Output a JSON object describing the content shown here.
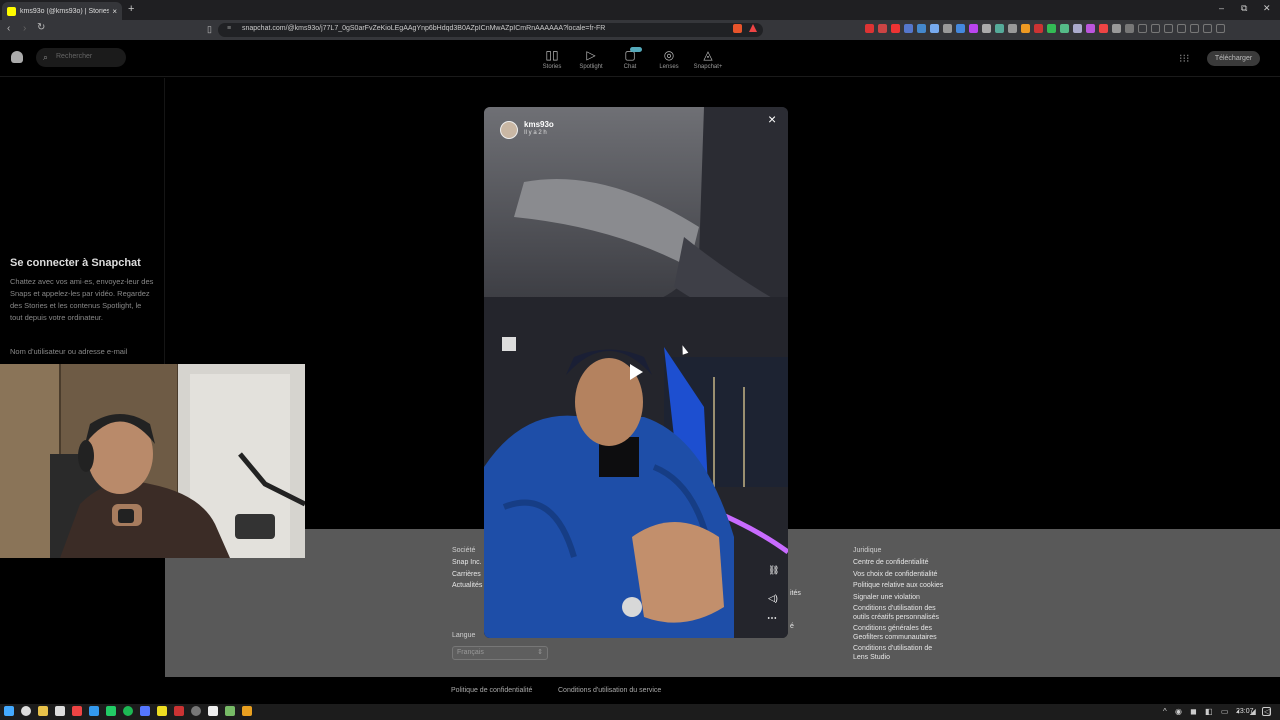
{
  "browser": {
    "tab_title": "kms93o (@kms93o) | Stories, Sp",
    "tab_close": "×",
    "new_tab": "+",
    "window_controls": [
      "–",
      "⧉",
      "✕"
    ],
    "url": "snapchat.com/@kms93o/j77L7_0gS0arFvZeKioLEgAAgYnp6bHdqd3B0AZpICnMwAZpICmRnAAAAAA?locale=fr-FR",
    "nav_icons": [
      "back-icon",
      "forward-icon",
      "reload-icon"
    ]
  },
  "header": {
    "search_placeholder": "Rechercher",
    "nav": [
      {
        "label": "Stories",
        "icon": "stories-icon"
      },
      {
        "label": "Spotlight",
        "icon": "spotlight-icon"
      },
      {
        "label": "Chat",
        "icon": "chat-icon"
      },
      {
        "label": "Lenses",
        "icon": "lenses-icon"
      },
      {
        "label": "Snapchat+",
        "icon": "snapchat-plus-icon"
      }
    ],
    "download_label": "Télécharger"
  },
  "login_panel": {
    "title": "Se connecter à Snapchat",
    "description": "Chattez avec vos ami·es, envoyez-leur des Snaps et appelez-les par vidéo. Regardez des Stories et les contenus Spotlight, le tout depuis votre ordinateur.",
    "username_label": "Nom d'utilisateur ou adresse e-mail"
  },
  "story": {
    "username": "kms93o",
    "time_ago": "Il y a 2 h"
  },
  "footer": {
    "col1_heading": "Société",
    "col1": [
      "Snap Inc.",
      "Carrières",
      "Actualités"
    ],
    "partial_text": [
      "ités",
      "é"
    ],
    "col3_heading": "Juridique",
    "col3": [
      "Centre de confidentialité",
      "Vos choix de confidentialité",
      "Politique relative aux cookies",
      "Signaler une violation",
      "Conditions d'utilisation des outils créatifs personnalisés",
      "Conditions générales des Geofilters communautaires",
      "Conditions d'utilisation de Lens Studio"
    ],
    "language_label": "Langue",
    "language_value": "Français",
    "bottom_links": [
      "Politique de confidentialité",
      "Conditions d'utilisation du service"
    ]
  },
  "taskbar": {
    "clock": "23:07"
  },
  "colors": {
    "snap_yellow": "#fffc00",
    "footer_bg": "#595959",
    "chrome_bg": "#35363a"
  }
}
